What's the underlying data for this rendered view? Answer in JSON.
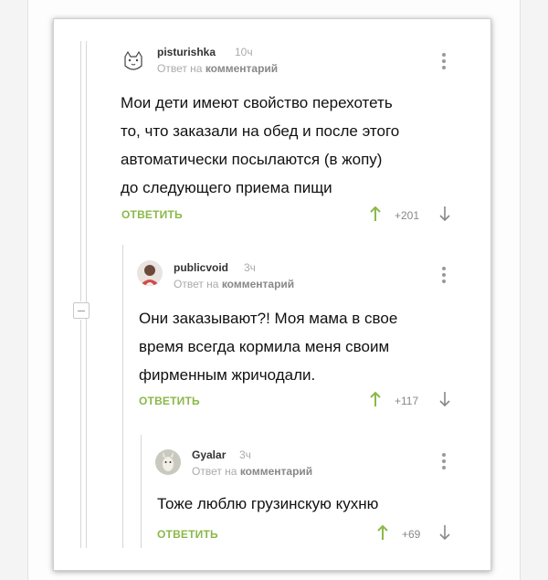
{
  "colors": {
    "accent": "#8bb84a",
    "muted": "#aaaaaa",
    "text": "#111111"
  },
  "comments": [
    {
      "username": "pisturishka",
      "time": "10ч",
      "reply_prefix": "Ответ на",
      "reply_target": "комментарий",
      "lines": [
        "Мои дети имеют свойство перехотеть",
        "то, что заказали на обед и после этого",
        "автоматически посылаются (в жопу)",
        "до следующего приема пищи"
      ],
      "reply_label": "ОТВЕТИТЬ",
      "rating": "+201",
      "avatar_icon": "cat-avatar-icon"
    },
    {
      "username": "publicvoid",
      "time": "3ч",
      "reply_prefix": "Ответ на",
      "reply_target": "комментарий",
      "lines": [
        "Они заказывают?! Моя мама в свое",
        "время всегда кормила меня своим",
        "фирменным жричодали."
      ],
      "reply_label": "ОТВЕТИТЬ",
      "rating": "+117",
      "avatar_icon": "person-avatar-icon"
    },
    {
      "username": "Gyalar",
      "time": "3ч",
      "reply_prefix": "Ответ на",
      "reply_target": "комментарий",
      "lines": [
        "Тоже люблю грузинскую кухню"
      ],
      "reply_label": "ОТВЕТИТЬ",
      "rating": "+69",
      "avatar_icon": "llama-avatar-icon"
    }
  ]
}
